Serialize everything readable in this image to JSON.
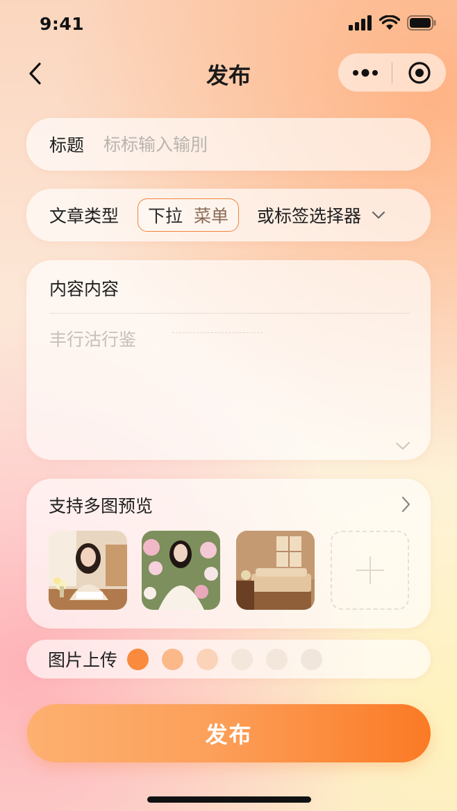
{
  "status_bar": {
    "time": "9:41"
  },
  "nav": {
    "title": "发布"
  },
  "form": {
    "title_label": "标题",
    "title_placeholder": "标标输入输刖",
    "type_label": "文章类型",
    "dropdown_text_a": "下拉",
    "dropdown_text_b": "菜单",
    "tag_selector": "或标签选择器",
    "content_label": "内容内容",
    "content_placeholder": "丰行沽行鉴"
  },
  "photos": {
    "title": "支持多图预览",
    "items": [
      {
        "icon": "photo-woman-at-table"
      },
      {
        "icon": "photo-woman-in-garden"
      },
      {
        "icon": "photo-living-room"
      }
    ]
  },
  "upload": {
    "label": "图片上传",
    "dot_colors": [
      "#fa8a3e",
      "#fbb98a",
      "#fbd3b8",
      "#f3e6da",
      "#f3e6da",
      "#f1e6dc"
    ]
  },
  "publish_button": "发布",
  "colors": {
    "accent": "#fb7a25",
    "accent_light": "#fdb070"
  }
}
